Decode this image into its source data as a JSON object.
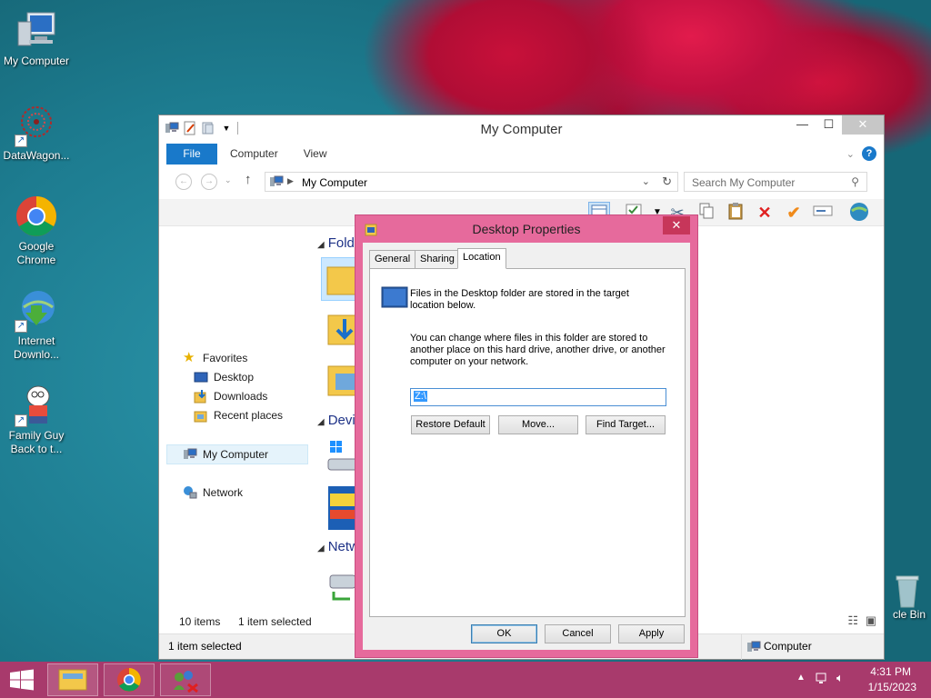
{
  "desktop": {
    "icons": [
      {
        "label": "My Computer",
        "icon": "computer-icon"
      },
      {
        "label": "DataWagon...",
        "icon": "datawagon-icon"
      },
      {
        "label": "Google Chrome",
        "icon": "chrome-icon"
      },
      {
        "label": "Internet Downlo...",
        "icon": "internet-download-icon"
      },
      {
        "label": "Family Guy Back to t...",
        "icon": "family-guy-icon"
      }
    ],
    "recycle_bin_label": "cle Bin"
  },
  "explorer": {
    "title": "My Computer",
    "tabs": {
      "file": "File",
      "computer": "Computer",
      "view": "View"
    },
    "help": "?",
    "address": "My Computer",
    "search_placeholder": "Search My Computer",
    "nav": {
      "favorites": "Favorites",
      "desktop": "Desktop",
      "downloads": "Downloads",
      "recent": "Recent places",
      "my_computer": "My Computer",
      "network": "Network"
    },
    "section_headers": {
      "folders": "Fold",
      "devices": "Devi",
      "network": "Netw"
    },
    "status": {
      "items": "10 items",
      "selected": "1 item selected"
    },
    "bottom": {
      "selected": "1 item selected",
      "computer": "Computer"
    }
  },
  "dialog": {
    "title": "Desktop Properties",
    "close": "✕",
    "tabs": {
      "general": "General",
      "sharing": "Sharing",
      "location": "Location"
    },
    "info_text_1": "Files in the Desktop folder are stored in the target",
    "info_text_2": "location below.",
    "desc_1": "You can change where files in this folder are stored to",
    "desc_2": "another place on this hard drive, another drive, or another",
    "desc_3": "computer on your network.",
    "path_value": "Z:\\",
    "buttons": {
      "restore": "Restore Default",
      "move": "Move...",
      "find": "Find Target...",
      "ok": "OK",
      "cancel": "Cancel",
      "apply": "Apply"
    }
  },
  "taskbar": {
    "time": "4:31 PM",
    "date": "1/15/2023"
  }
}
